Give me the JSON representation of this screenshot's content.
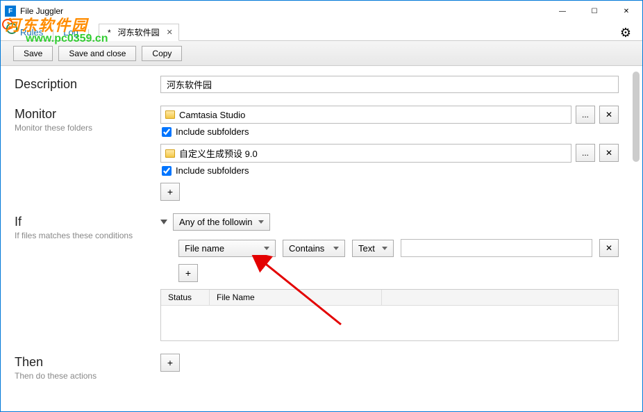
{
  "window": {
    "title": "File Juggler",
    "icon_letter": "F"
  },
  "watermark": {
    "text": "河东软件园",
    "url": "www.pc0359.cn"
  },
  "nav": {
    "rules": "Rules",
    "log": "Log"
  },
  "tab": {
    "name": "河东软件园",
    "dirty": "*"
  },
  "toolbar": {
    "save": "Save",
    "save_close": "Save and close",
    "copy": "Copy"
  },
  "sections": {
    "description": {
      "title": "Description"
    },
    "monitor": {
      "title": "Monitor",
      "sub": "Monitor these folders"
    },
    "if": {
      "title": "If",
      "sub": "If files matches these conditions"
    },
    "then": {
      "title": "Then",
      "sub": "Then do these actions"
    }
  },
  "description_value": "河东软件园",
  "folders": [
    {
      "name": "Camtasia Studio",
      "include_sub": true
    },
    {
      "name": "自定义生成预设 9.0",
      "include_sub": true
    }
  ],
  "include_subfolders_label": "Include subfolders",
  "condition": {
    "mode": "Any of the followin",
    "field": "File name",
    "op": "Contains",
    "type": "Text",
    "value": ""
  },
  "table": {
    "status": "Status",
    "filename": "File Name"
  },
  "icons": {
    "browse": "...",
    "remove": "✕",
    "add": "+",
    "close": "✕",
    "gear": "⚙"
  },
  "win": {
    "min": "—",
    "max": "☐",
    "close": "✕"
  }
}
